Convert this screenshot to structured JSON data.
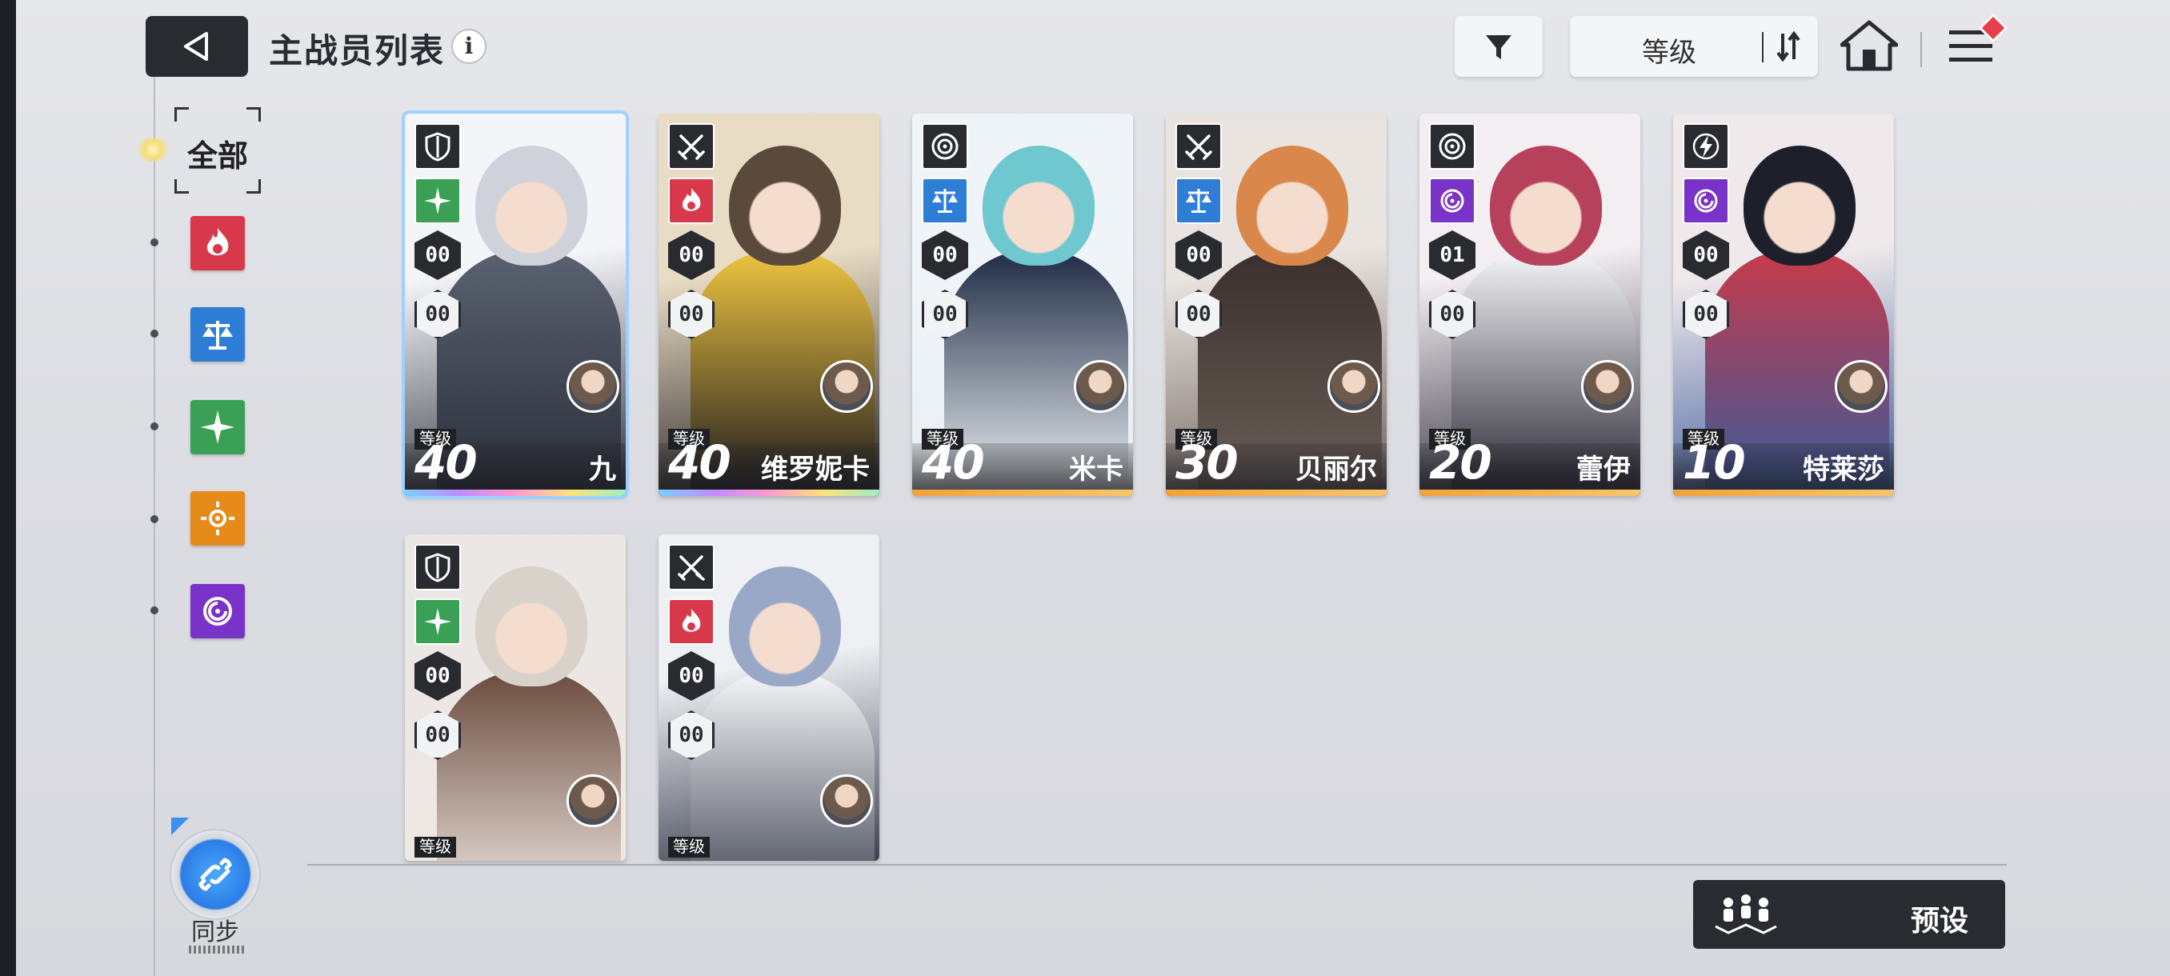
{
  "header": {
    "title": "主战员列表",
    "info_icon": "info-icon",
    "sort_label": "等级",
    "has_notification": true
  },
  "sidebar": {
    "filter_all_label": "全部",
    "elements": [
      {
        "name": "fire",
        "icon": "flame-icon",
        "color": "#d8394a"
      },
      {
        "name": "order",
        "icon": "scales-icon",
        "color": "#2e7ed6"
      },
      {
        "name": "wind",
        "icon": "star-cross-icon",
        "color": "#3aa055"
      },
      {
        "name": "light",
        "icon": "sun-icon",
        "color": "#e68a1a"
      },
      {
        "name": "void",
        "icon": "spiral-icon",
        "color": "#7a33c8"
      }
    ],
    "sync_label": "同步"
  },
  "cards": [
    {
      "name": "九",
      "level_label": "等级",
      "level": "40",
      "role": "shield-icon",
      "attr": "star-cross-icon",
      "attr_color": "#3aa055",
      "stat1": "00",
      "stat2": "00",
      "rarity": "rainbow",
      "selected": true
    },
    {
      "name": "维罗妮卡",
      "level_label": "等级",
      "level": "40",
      "role": "crossed-swords-icon",
      "attr": "flame-icon",
      "attr_color": "#d8394a",
      "stat1": "00",
      "stat2": "00",
      "rarity": "rainbow",
      "selected": false
    },
    {
      "name": "米卡",
      "level_label": "等级",
      "level": "40",
      "role": "target-icon",
      "attr": "scales-icon",
      "attr_color": "#2e7ed6",
      "stat1": "00",
      "stat2": "00",
      "rarity": "gold",
      "selected": false
    },
    {
      "name": "贝丽尔",
      "level_label": "等级",
      "level": "30",
      "role": "crossed-swords-icon",
      "attr": "scales-icon",
      "attr_color": "#2e7ed6",
      "stat1": "00",
      "stat2": "00",
      "rarity": "gold",
      "selected": false
    },
    {
      "name": "蕾伊",
      "level_label": "等级",
      "level": "20",
      "role": "target-icon",
      "attr": "spiral-icon",
      "attr_color": "#7a33c8",
      "stat1": "01",
      "stat2": "00",
      "rarity": "gold",
      "selected": false
    },
    {
      "name": "特莱莎",
      "level_label": "等级",
      "level": "10",
      "role": "lightning-icon",
      "attr": "spiral-icon",
      "attr_color": "#7a33c8",
      "stat1": "00",
      "stat2": "00",
      "rarity": "gold",
      "selected": false
    },
    {
      "name": "",
      "level_label": "等级",
      "level": "",
      "role": "shield-icon",
      "attr": "star-cross-icon",
      "attr_color": "#3aa055",
      "stat1": "00",
      "stat2": "00",
      "rarity": "none",
      "selected": false
    },
    {
      "name": "",
      "level_label": "等级",
      "level": "",
      "role": "crossed-swords-x-icon",
      "attr": "flame-icon",
      "attr_color": "#d8394a",
      "stat1": "00",
      "stat2": "00",
      "rarity": "none",
      "selected": false
    }
  ],
  "footer": {
    "preset_label": "预设"
  }
}
